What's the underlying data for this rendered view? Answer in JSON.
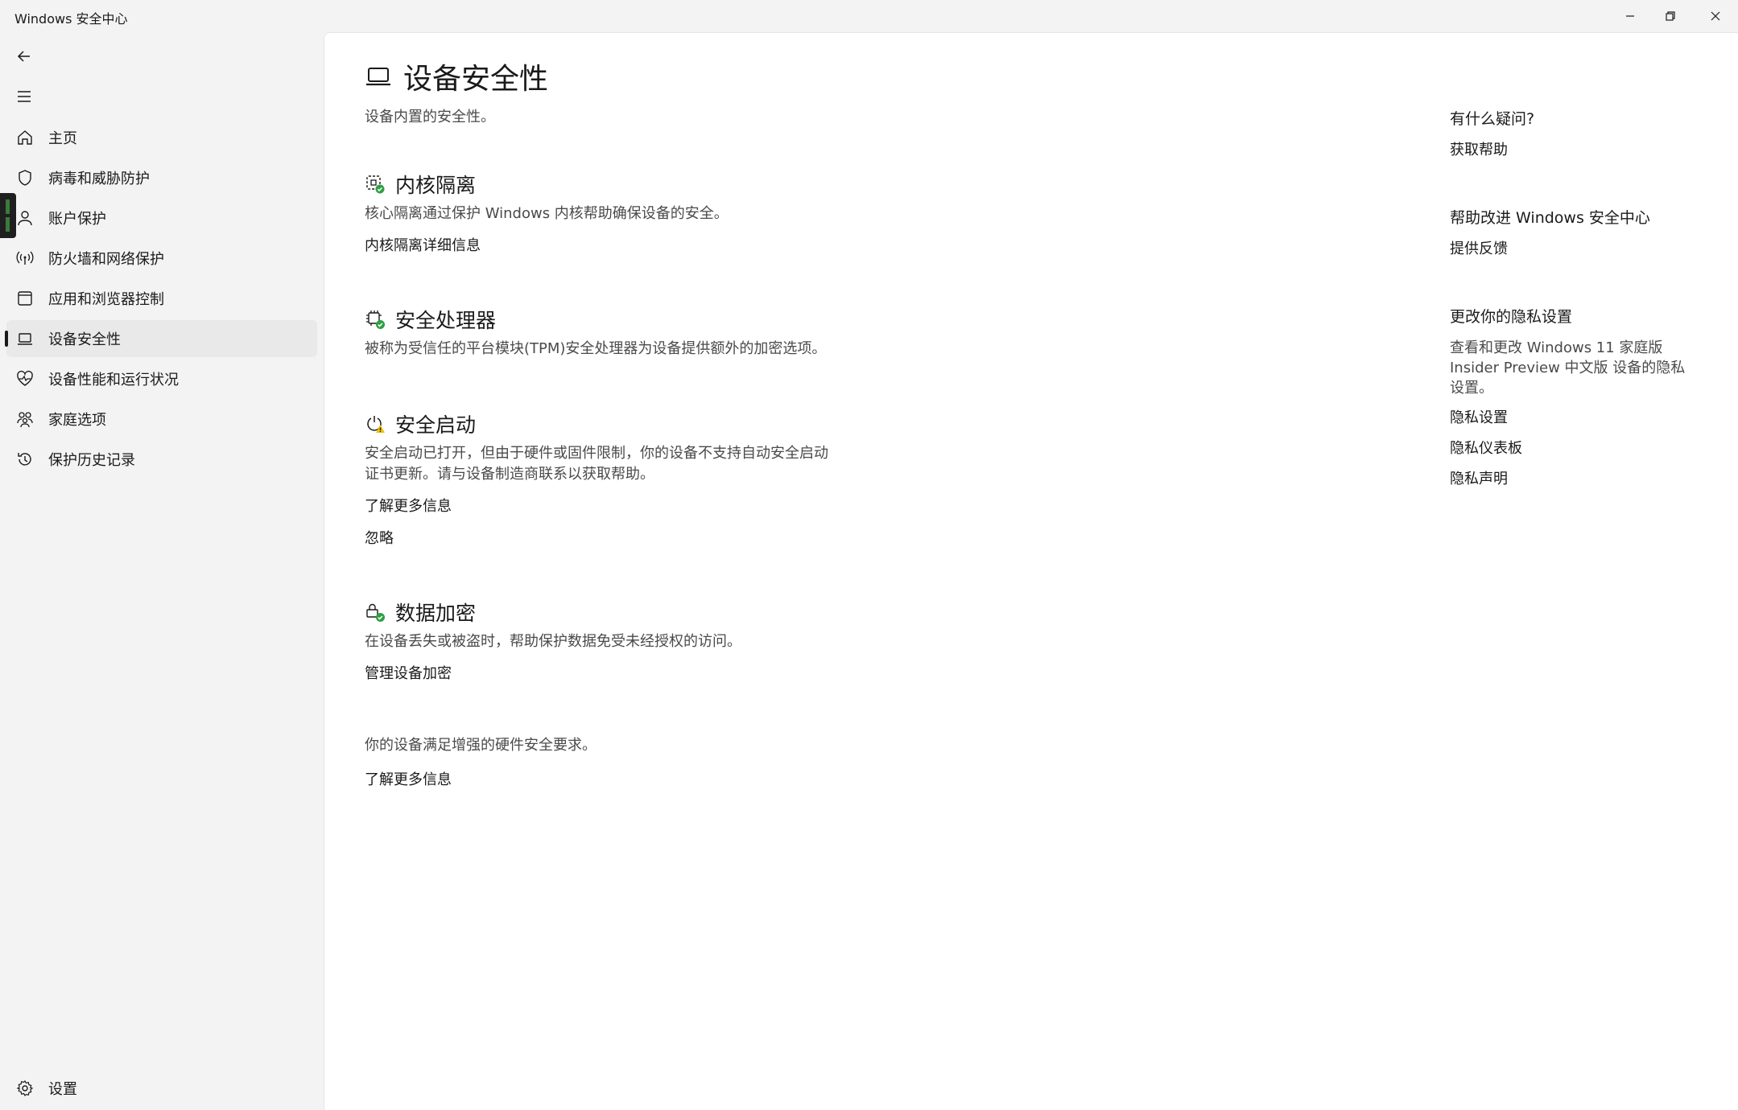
{
  "window": {
    "title": "Windows 安全中心"
  },
  "sidebar": {
    "items": [
      {
        "label": "主页",
        "icon": "home-icon"
      },
      {
        "label": "病毒和威胁防护",
        "icon": "shield-icon"
      },
      {
        "label": "账户保护",
        "icon": "person-icon"
      },
      {
        "label": "防火墙和网络保护",
        "icon": "wifi-antenna-icon"
      },
      {
        "label": "应用和浏览器控制",
        "icon": "browser-window-icon"
      },
      {
        "label": "设备安全性",
        "icon": "laptop-icon",
        "active": true
      },
      {
        "label": "设备性能和运行状况",
        "icon": "heart-pulse-icon"
      },
      {
        "label": "家庭选项",
        "icon": "family-icon"
      },
      {
        "label": "保护历史记录",
        "icon": "history-icon"
      }
    ],
    "settings_label": "设置"
  },
  "main": {
    "title": "设备安全性",
    "subtitle": "设备内置的安全性。",
    "sections": [
      {
        "title": "内核隔离",
        "description": "核心隔离通过保护 Windows 内核帮助确保设备的安全。",
        "links": [
          "内核隔离详细信息"
        ],
        "status": "ok"
      },
      {
        "title": "安全处理器",
        "description": "被称为受信任的平台模块(TPM)安全处理器为设备提供额外的加密选项。",
        "links": [],
        "status": "ok"
      },
      {
        "title": "安全启动",
        "description_lines": [
          "安全启动已打开，但由于硬件或固件限制，你的设备不支持自动安全启动",
          "证书更新。请与设备制造商联系以获取帮助。"
        ],
        "links": [
          "了解更多信息",
          "忽略"
        ],
        "status": "warning"
      },
      {
        "title": "数据加密",
        "description": "在设备丢失或被盗时，帮助保护数据免受未经授权的访问。",
        "links": [
          "管理设备加密"
        ],
        "status": "ok"
      }
    ],
    "footer_text": "你的设备满足增强的硬件安全要求。",
    "footer_link": "了解更多信息"
  },
  "right_panel": {
    "question_heading": "有什么疑问?",
    "get_help": "获取帮助",
    "improve_heading": "帮助改进 Windows 安全中心",
    "feedback": "提供反馈",
    "privacy_heading": "更改你的隐私设置",
    "privacy_text_lines": [
      "查看和更改 Windows 11 家庭版",
      "Insider Preview 中文版 设备的隐私",
      "设置。"
    ],
    "privacy_settings": "隐私设置",
    "privacy_dashboard": "隐私仪表板",
    "privacy_statement": "隐私声明"
  },
  "colors": {
    "ok_badge": "#2ea043",
    "warning_badge": "#f2c200",
    "active_nav_bg": "#e9e9e9"
  }
}
